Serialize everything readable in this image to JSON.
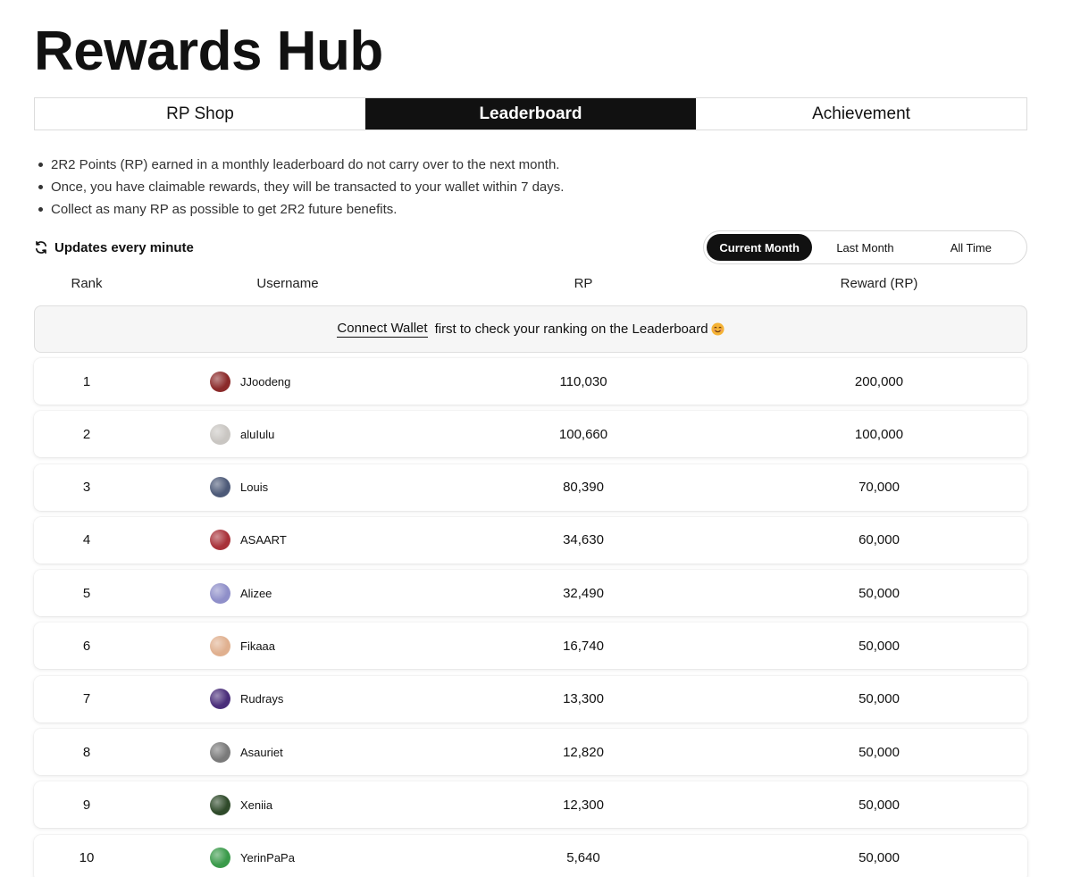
{
  "page": {
    "title": "Rewards Hub"
  },
  "tabs": [
    {
      "label": "RP Shop",
      "active": false
    },
    {
      "label": "Leaderboard",
      "active": true
    },
    {
      "label": "Achievement",
      "active": false
    }
  ],
  "notes": [
    "2R2 Points (RP) earned in a monthly leaderboard do not carry over to the next month.",
    "Once, you have claimable rewards, they will be transacted to your wallet within 7 days.",
    "Collect as many RP as possible to get 2R2 future benefits."
  ],
  "updates": {
    "label": "Updates every minute",
    "icon": "refresh-icon"
  },
  "period": {
    "options": [
      "Current Month",
      "Last Month",
      "All Time"
    ],
    "selected": "Current Month"
  },
  "table": {
    "columns": [
      "Rank",
      "Username",
      "RP",
      "Reward (RP)"
    ],
    "banner": {
      "link": "Connect Wallet",
      "text": "first to check your ranking on the Leaderboard",
      "emoji_icon": "smiling-face-icon"
    },
    "rows": [
      {
        "rank": "1",
        "username": "JJoodeng",
        "rp": "110,030",
        "reward": "200,000",
        "avatar_color": "#8b2a2a"
      },
      {
        "rank": "2",
        "username": "aluIulu",
        "rp": "100,660",
        "reward": "100,000",
        "avatar_color": "#c9c6c2"
      },
      {
        "rank": "3",
        "username": "Louis",
        "rp": "80,390",
        "reward": "70,000",
        "avatar_color": "#4d5a78"
      },
      {
        "rank": "4",
        "username": "ASAART",
        "rp": "34,630",
        "reward": "60,000",
        "avatar_color": "#a8323a"
      },
      {
        "rank": "5",
        "username": "Alizee",
        "rp": "32,490",
        "reward": "50,000",
        "avatar_color": "#8f8fc9"
      },
      {
        "rank": "6",
        "username": "Fikaaa",
        "rp": "16,740",
        "reward": "50,000",
        "avatar_color": "#e0b08f"
      },
      {
        "rank": "7",
        "username": "Rudrays",
        "rp": "13,300",
        "reward": "50,000",
        "avatar_color": "#4a2e7a"
      },
      {
        "rank": "8",
        "username": "Asauriet",
        "rp": "12,820",
        "reward": "50,000",
        "avatar_color": "#7a7a7a"
      },
      {
        "rank": "9",
        "username": "Xeniia",
        "rp": "12,300",
        "reward": "50,000",
        "avatar_color": "#2f4a2a"
      },
      {
        "rank": "10",
        "username": "YerinPaPa",
        "rp": "5,640",
        "reward": "50,000",
        "avatar_color": "#3a9a4a"
      }
    ]
  }
}
